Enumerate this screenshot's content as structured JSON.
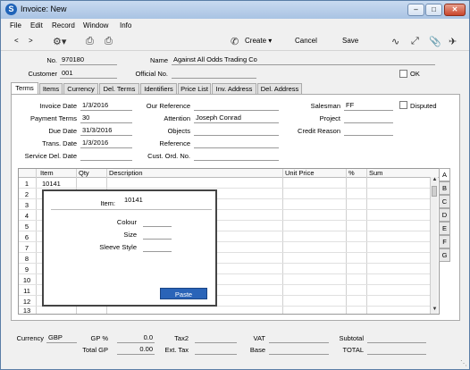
{
  "window": {
    "title": "Invoice: New",
    "app_icon": "S"
  },
  "menu": [
    "File",
    "Edit",
    "Record",
    "Window",
    "Info"
  ],
  "toolbar": {
    "back_icon": "<",
    "forward_icon": ">",
    "create": "Create",
    "cancel": "Cancel",
    "save": "Save"
  },
  "header": {
    "no_label": "No.",
    "no_value": "970180",
    "name_label": "Name",
    "name_value": "Against All Odds Trading Co",
    "customer_label": "Customer",
    "customer_value": "001",
    "official_label": "Official No.",
    "official_value": "",
    "ok_label": "OK"
  },
  "tabs": [
    "Terms",
    "Items",
    "Currency",
    "Del. Terms",
    "Identifiers",
    "Price List",
    "Inv. Address",
    "Del. Address"
  ],
  "terms": {
    "invoice_date_label": "Invoice Date",
    "invoice_date": "1/3/2016",
    "payment_terms_label": "Payment Terms",
    "payment_terms": "30",
    "due_date_label": "Due Date",
    "due_date": "31/3/2016",
    "trans_date_label": "Trans. Date",
    "trans_date": "1/3/2016",
    "service_del_label": "Service Del. Date",
    "service_del": "",
    "our_ref_label": "Our Reference",
    "our_ref": "",
    "attention_label": "Attention",
    "attention": "Joseph Conrad",
    "objects_label": "Objects",
    "objects": "",
    "reference_label": "Reference",
    "reference": "",
    "cust_ord_label": "Cust. Ord. No.",
    "cust_ord": "",
    "salesman_label": "Salesman",
    "salesman": "FF",
    "disputed_label": "Disputed",
    "project_label": "Project",
    "project": "",
    "credit_reason_label": "Credit Reason",
    "credit_reason": ""
  },
  "grid": {
    "columns": [
      "Item",
      "Qty",
      "Description",
      "Unit Price",
      "%",
      "Sum"
    ],
    "rows": [
      "1",
      "2",
      "3",
      "4",
      "5",
      "6",
      "7",
      "8",
      "9",
      "10",
      "11",
      "12",
      "13"
    ],
    "row1_item": "10141"
  },
  "side_tabs": [
    "A",
    "B",
    "C",
    "D",
    "E",
    "F",
    "G"
  ],
  "popup": {
    "item_label": "Item:",
    "item_value": "10141",
    "colour_label": "Colour",
    "size_label": "Size",
    "sleeve_label": "Sleeve Style",
    "paste_button": "Paste"
  },
  "footer": {
    "currency_label": "Currency",
    "currency": "GBP",
    "gp_pct_label": "GP %",
    "gp_pct": "0.0",
    "total_gp_label": "Total GP",
    "total_gp": "0.00",
    "tax2_label": "Tax2",
    "tax2": "",
    "ext_tax_label": "Ext. Tax",
    "ext_tax": "",
    "vat_label": "VAT",
    "vat": "",
    "base_label": "Base",
    "base": "",
    "subtotal_label": "Subtotal",
    "subtotal": "",
    "total_label": "TOTAL",
    "total": ""
  },
  "colors": {
    "accent": "#2a64b8",
    "title_bar": "#b9cfe9"
  }
}
